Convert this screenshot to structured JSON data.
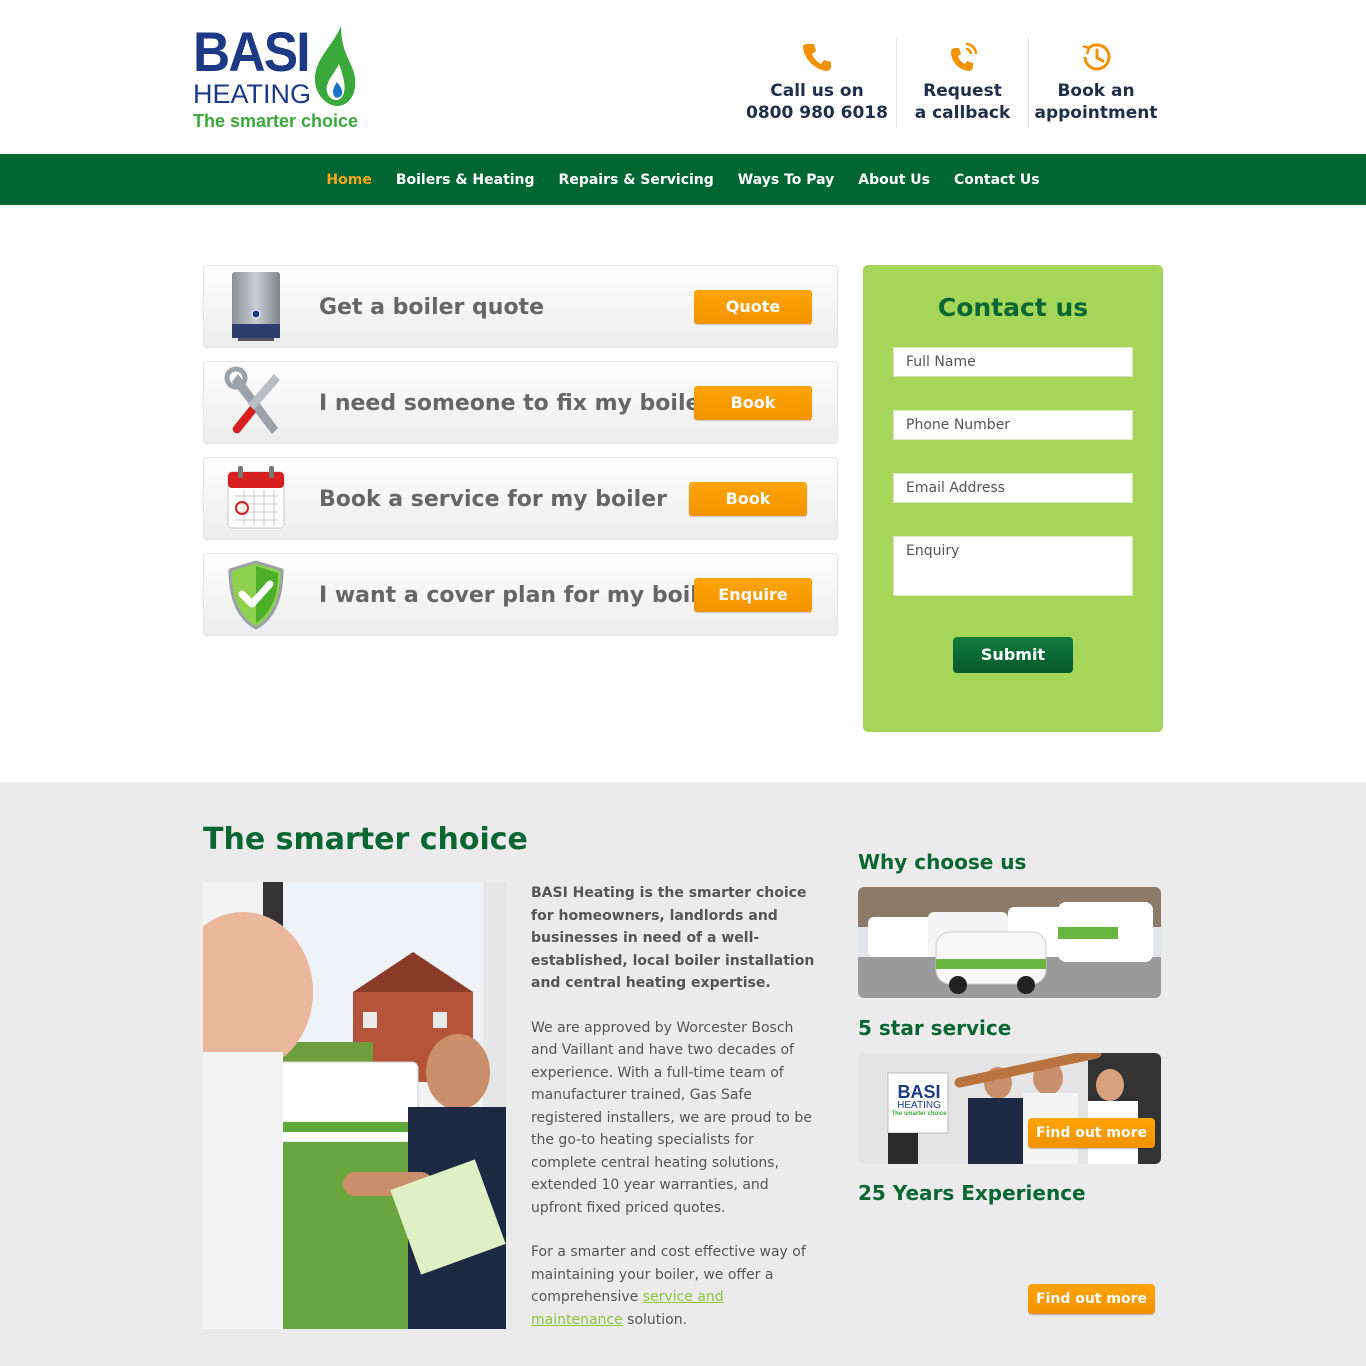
{
  "brand": {
    "name_line1": "BASI",
    "name_line2": "HEATING",
    "tagline": "The smarter choice"
  },
  "header_links": [
    {
      "line1": "Call us on",
      "line2": "0800 980 6018",
      "icon": "phone-icon"
    },
    {
      "line1": "Request",
      "line2": "a callback",
      "icon": "phone-ringing-icon"
    },
    {
      "line1": "Book an",
      "line2": "appointment",
      "icon": "clock-icon"
    }
  ],
  "nav": {
    "items": [
      "Home",
      "Boilers & Heating",
      "Repairs & Servicing",
      "Ways To Pay",
      "About Us",
      "Contact Us"
    ],
    "active": "Home"
  },
  "actions": [
    {
      "text": "Get a boiler quote",
      "button": "Quote",
      "icon": "boiler-icon"
    },
    {
      "text": "I need someone to fix my boiler",
      "button": "Book",
      "icon": "tools-icon"
    },
    {
      "text": "Book a service for my boiler",
      "button": "Book",
      "icon": "calendar-icon"
    },
    {
      "text": "I want a cover plan for my boiler",
      "button": "Enquire",
      "icon": "shield-check-icon"
    }
  ],
  "contact_form": {
    "title": "Contact us",
    "full_name_placeholder": "Full Name",
    "phone_placeholder": "Phone Number",
    "email_placeholder": "Email Address",
    "enquiry_placeholder": "Enquiry",
    "submit": "Submit"
  },
  "smarter": {
    "heading": "The smarter choice",
    "lead": "BASI Heating is the smarter choice for homeowners, landlords and businesses in need of a well-established, local boiler installation and central heating expertise.",
    "para2": "We are approved by Worcester Bosch and Vaillant and have two decades of experience. With a full-time team of manufacturer trained, Gas Safe registered installers, we are proud to be the go-to heating specialists for complete central heating solutions, extended 10 year warranties, and upfront fixed priced quotes.",
    "para3_before": "For a smarter and cost effective way of maintaining your boiler, we offer a comprehensive ",
    "para3_link": "service and maintenance",
    "para3_after": " solution."
  },
  "side": {
    "why_title": "Why choose us",
    "five_star_title": "5 star service",
    "years_title": "25 Years Experience",
    "find_out_more": "Find out more",
    "team_sign_line1": "BASI",
    "team_sign_line2": "HEATING",
    "team_sign_line3": "The smarter choice"
  },
  "colors": {
    "nav_green": "#006633",
    "accent_orange": "#f7a51d",
    "form_green": "#a5d65a",
    "heading_green": "#0a6633",
    "brand_blue": "#1d3a87"
  }
}
